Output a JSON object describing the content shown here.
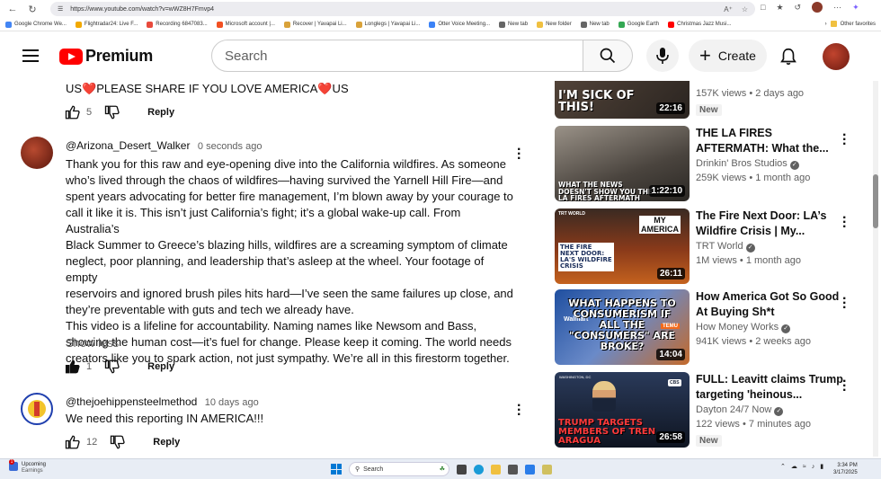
{
  "browser": {
    "url": "https://www.youtube.com/watch?v=wWZ8H7Fmvp4",
    "bookmarks": [
      {
        "label": "Google Chrome We...",
        "color": "#4285f4"
      },
      {
        "label": "Flightradar24: Live F...",
        "color": "#f2a900"
      },
      {
        "label": "Recording 6847083...",
        "color": "#e84a3c"
      },
      {
        "label": "Microsoft account |...",
        "color": "#f25022"
      },
      {
        "label": "Recover | Yavapai Li...",
        "color": "#d9a23a"
      },
      {
        "label": "Longlegs | Yavapai Li...",
        "color": "#d9a23a"
      },
      {
        "label": "Otter Voice Meeting...",
        "color": "#3b82f6"
      },
      {
        "label": "New tab",
        "color": "#666666"
      },
      {
        "label": "New folder",
        "color": "#f0c040"
      },
      {
        "label": "New tab",
        "color": "#666666"
      },
      {
        "label": "Google Earth",
        "color": "#34a853"
      },
      {
        "label": "Christmas Jazz Musi...",
        "color": "#ff0000"
      }
    ],
    "other_favorites": "Other favorites"
  },
  "header": {
    "logo_text": "Premium",
    "search_placeholder": "Search",
    "create_label": "Create"
  },
  "comments": {
    "first_partial": {
      "text": "US❤️PLEASE SHARE IF YOU LOVE AMERICA❤️US",
      "likes": "5",
      "reply": "Reply"
    },
    "main": {
      "handle": "@Arizona_Desert_Walker",
      "time": "0 seconds ago",
      "lines": [
        "Thank you for this raw and eye-opening dive into the California wildfires. As someone",
        "who’s lived through the chaos of wildfires—having survived the Yarnell Hill Fire—and",
        "spent years advocating for better fire management, I’m blown away by your courage to",
        "call it like it is. This isn’t just California’s fight; it’s a global wake-up call. From Australia’s",
        "Black Summer to Greece’s blazing hills, wildfires are a screaming symptom of climate",
        "neglect, poor planning, and leadership that’s asleep at the wheel. Your footage of empty",
        "reservoirs and ignored brush piles hits hard—I’ve seen the same failures up close, and",
        "they’re preventable with guts and tech we already have.",
        "This video is a lifeline for accountability. Naming names like Newsom and Bass,",
        "showing the human cost—it’s fuel for change. Please keep it coming. The world needs",
        "creators like you to spark action, not just sympathy. We’re all in this firestorm together."
      ],
      "show_less": "Show less",
      "likes": "1",
      "reply": "Reply"
    },
    "third": {
      "handle": "@thejoehippensteelmethod",
      "time": "10 days ago",
      "text": "We need this reporting IN AMERICA!!!",
      "likes": "12",
      "reply": "Reply"
    }
  },
  "sidebar": {
    "videos": [
      {
        "thumb_caption": "I'M SICK OF THIS!",
        "duration": "22:16",
        "title_lines": [],
        "channel": "",
        "views": "157K views",
        "age": "2 days ago",
        "badge": "New"
      },
      {
        "thumb_caption": "WHAT THE NEWS DOESN'T SHOW YOU THE LA FIRES AFTERMATH",
        "duration": "1:22:10",
        "title_lines": [
          "THE LA FIRES",
          "AFTERMATH: What the..."
        ],
        "channel": "Drinkin' Bros Studios",
        "views": "259K views",
        "age": "1 month ago",
        "badge": ""
      },
      {
        "thumb_caption": "THE FIRE NEXT DOOR: LA'S WILDFIRE CRISIS",
        "duration": "26:11",
        "title_lines": [
          "The Fire Next Door: LA’s",
          "Wildfire Crisis | My..."
        ],
        "channel": "TRT World",
        "views": "1M views",
        "age": "1 month ago",
        "badge": ""
      },
      {
        "thumb_caption": "WHAT HAPPENS TO CONSUMERISM IF ALL THE \"CONSUMERS\" ARE BROKE?",
        "duration": "14:04",
        "title_lines": [
          "How America Got So Good",
          "At Buying Sh*t"
        ],
        "channel": "How Money Works",
        "views": "941K views",
        "age": "2 weeks ago",
        "badge": ""
      },
      {
        "thumb_caption": "TRUMP TARGETS MEMBERS OF TREN ARAGUA",
        "duration": "26:58",
        "title_lines": [
          "FULL: Leavitt claims Trump",
          "targeting 'heinous..."
        ],
        "channel": "Dayton 24/7 Now",
        "views": "122 views",
        "age": "7 minutes ago",
        "badge": "New"
      }
    ],
    "thumb_text": {
      "my_america": "MY AMERICA",
      "trt_world": "TRT WORLD",
      "walmart": "Walmart",
      "temu": "TEMU",
      "washington": "WASHINGTON, DC",
      "cbs": "CBS"
    }
  },
  "taskbar": {
    "weather_title": "Upcoming",
    "weather_sub": "Earnings",
    "search_label": "Search",
    "time": "3:34 PM",
    "date": "3/17/2025"
  }
}
